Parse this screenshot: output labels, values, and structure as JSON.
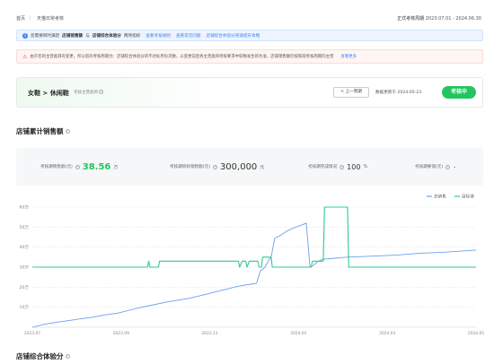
{
  "breadcrumb": {
    "home": "首页",
    "separator": "〉",
    "current": "天猫日常考核"
  },
  "period": {
    "label": "正式考核周期",
    "range": "2023.07.01 - 2024.06.30"
  },
  "info_banner": {
    "text1": "您需要同时满足",
    "strong1": "店铺销售额",
    "mid": "与",
    "strong2": "店铺综合体验分",
    "text2": "两项指标",
    "link1": "查看考核规则",
    "link2": "查看常见问题",
    "link3": "店铺综合体验分快速提升攻略"
  },
  "warn_banner": {
    "text": "由于您的主营类目有变更，所以您的考核周期为：店铺综合体验分的不达标月份次数，以变更前后各主营类目考核要求中较晚发生的为准，店铺销售额仍按照现考核周期的主营",
    "link": "查看更多"
  },
  "category_card": {
    "title": "女鞋 > 休闲鞋",
    "subtitle": "考核主营类目",
    "prev_button": "< 上一周期",
    "updated": "数据更新于 2024-05-23",
    "status": "考核中"
  },
  "sales_section_title": "店铺累计销售额",
  "metrics": [
    {
      "label": "考核期销售额(元)",
      "value": "38.56",
      "unit": "万"
    },
    {
      "label": "考核期目标销售额(元)",
      "value": "300,000",
      "unit": "元"
    },
    {
      "label": "考核期完成情况",
      "value": "100",
      "unit": "%"
    },
    {
      "label": "考核期要值(元)",
      "value": ""
    }
  ],
  "bottom_section_title": "店铺综合体验分",
  "colors": {
    "sales_line": "#6b9ff0",
    "target_line": "#2ecc8f",
    "accent_green": "#22c55e"
  },
  "chart_data": {
    "type": "line",
    "legend": [
      "总销售",
      "目标值"
    ],
    "x_labels": [
      "2023.07",
      "2023.09",
      "2023.11",
      "2024.01",
      "2024.03",
      "2024.05"
    ],
    "y_labels": [
      "60万",
      "50万",
      "40万",
      "30万",
      "20万",
      "10万"
    ],
    "ylim": [
      0,
      60
    ],
    "series": [
      {
        "name": "总销售",
        "points": [
          [
            0,
            0
          ],
          [
            10,
            1.5
          ],
          [
            20,
            2.5
          ],
          [
            30,
            3.3
          ],
          [
            40,
            4.2
          ],
          [
            50,
            5
          ],
          [
            60,
            6.2
          ],
          [
            70,
            7
          ],
          [
            80,
            8.5
          ],
          [
            90,
            10
          ],
          [
            100,
            11.2
          ],
          [
            110,
            12.5
          ],
          [
            120,
            13.5
          ],
          [
            130,
            14.5
          ],
          [
            140,
            16
          ],
          [
            150,
            17.5
          ],
          [
            160,
            19
          ],
          [
            170,
            20.5
          ],
          [
            180,
            21.5
          ],
          [
            185,
            22
          ],
          [
            188,
            28
          ],
          [
            192,
            30
          ],
          [
            195,
            33.5
          ],
          [
            197,
            35
          ],
          [
            200,
            44.5
          ],
          [
            205,
            46
          ],
          [
            210,
            48
          ],
          [
            215,
            49.5
          ],
          [
            222,
            51
          ],
          [
            226,
            52
          ],
          [
            229,
            30
          ],
          [
            232,
            31
          ],
          [
            236,
            33
          ],
          [
            240,
            34
          ],
          [
            250,
            34.5
          ],
          [
            260,
            35
          ],
          [
            280,
            35.5
          ],
          [
            300,
            36
          ],
          [
            320,
            37
          ],
          [
            340,
            37.5
          ],
          [
            366,
            38.56
          ]
        ]
      },
      {
        "name": "目标值",
        "points": [
          [
            0,
            30
          ],
          [
            95,
            30
          ],
          [
            96,
            33
          ],
          [
            97,
            30
          ],
          [
            104,
            30
          ],
          [
            105,
            33
          ],
          [
            170,
            33
          ],
          [
            171,
            30
          ],
          [
            173,
            33
          ],
          [
            176,
            33
          ],
          [
            177,
            30
          ],
          [
            179,
            33
          ],
          [
            186,
            33
          ],
          [
            187,
            30
          ],
          [
            189,
            30
          ],
          [
            190,
            35
          ],
          [
            197,
            35
          ],
          [
            198,
            30
          ],
          [
            230,
            30
          ],
          [
            231,
            33
          ],
          [
            240,
            33
          ],
          [
            241,
            60
          ],
          [
            260,
            60
          ],
          [
            261,
            30
          ],
          [
            366,
            30
          ]
        ]
      }
    ],
    "x_range": [
      0,
      366
    ]
  }
}
